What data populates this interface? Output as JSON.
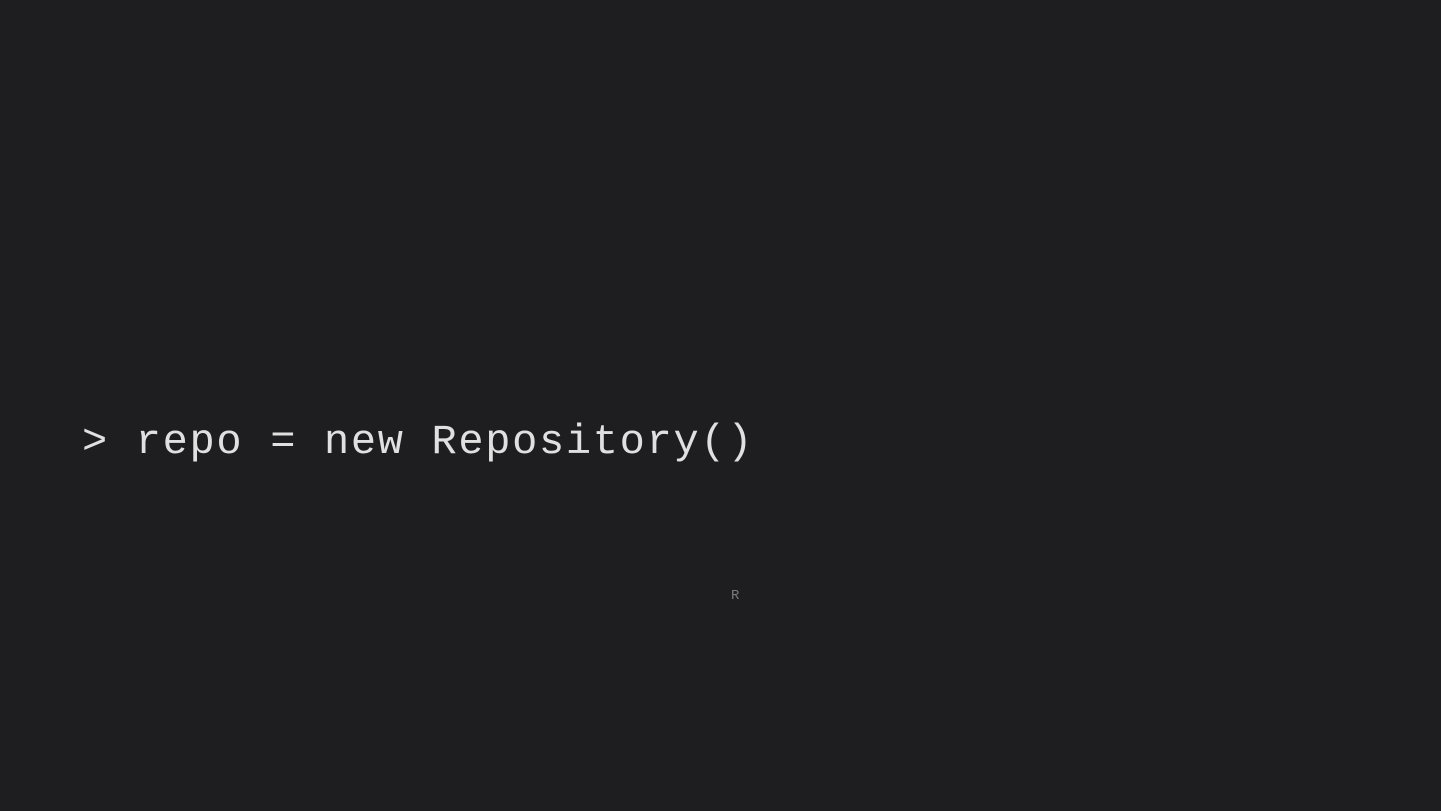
{
  "slide": {
    "code_line": "> repo = new Repository()",
    "stray_letter": "R"
  }
}
